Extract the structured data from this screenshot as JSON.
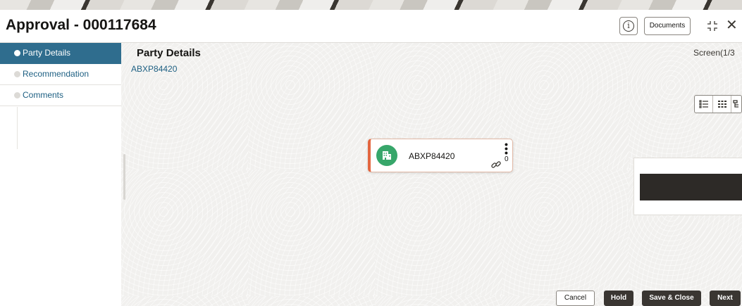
{
  "header": {
    "title": "Approval - 000117684",
    "documents_label": "Documents",
    "info_icon": "info-icon",
    "expand_icon": "collapse-expand-icon",
    "close_icon": "close-icon"
  },
  "sidebar": {
    "items": [
      {
        "label": "Party Details",
        "active": true
      },
      {
        "label": "Recommendation",
        "active": false
      },
      {
        "label": "Comments",
        "active": false
      }
    ]
  },
  "main": {
    "title": "Party Details",
    "party_id": "ABXP84420",
    "screen_indicator": "Screen(1/3",
    "view_icons": [
      "list-view-icon",
      "grid-view-icon",
      "tree-view-icon"
    ]
  },
  "node": {
    "label": "ABXP84420",
    "avatar_icon": "building-icon",
    "link_count": "0",
    "link_icon": "link-icon",
    "menu_icon": "kebab-menu-icon",
    "accent_color": "#e3663f",
    "avatar_color": "#37a66a"
  },
  "footer": {
    "cancel_label": "Cancel",
    "hold_label": "Hold",
    "save_close_label": "Save & Close",
    "next_label": "Next"
  }
}
